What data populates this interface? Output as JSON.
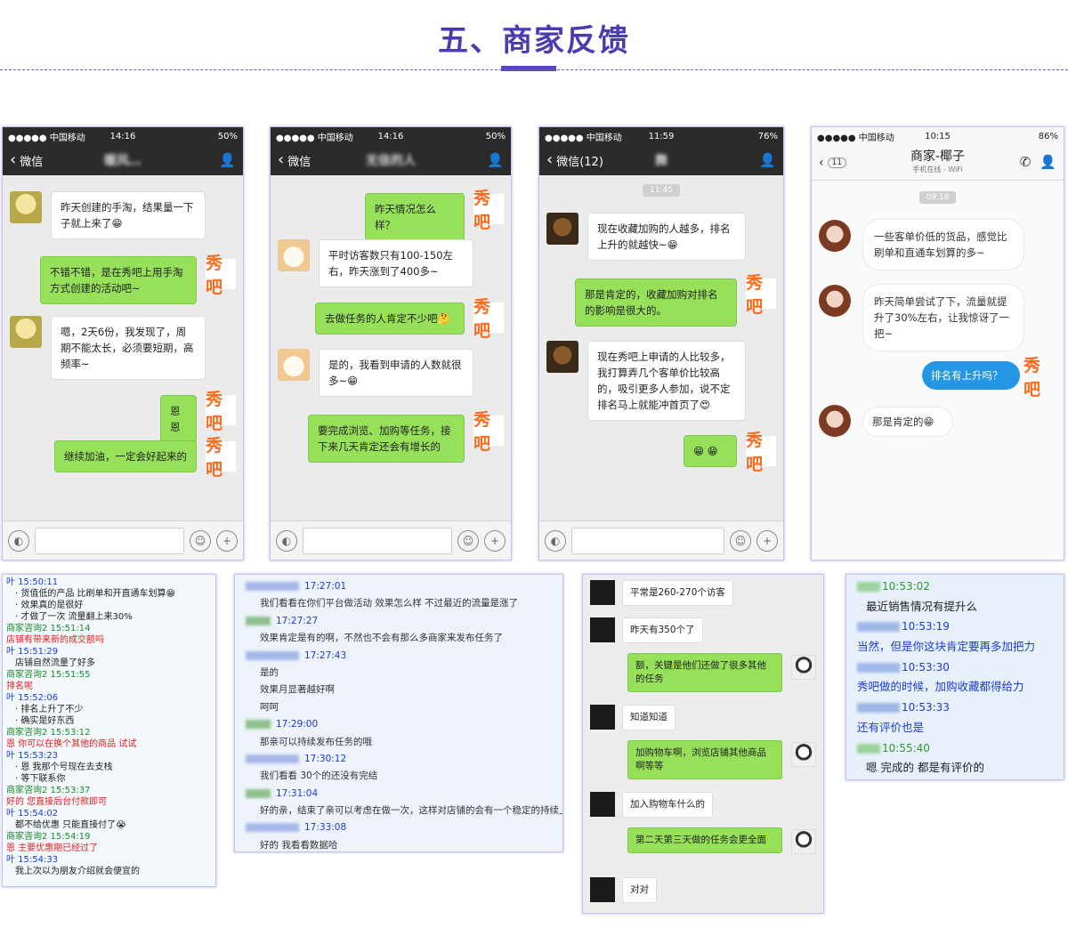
{
  "page": {
    "title": "五、商家反馈"
  },
  "xiuba_label": "秀吧",
  "phone1": {
    "carrier": "●●●●● 中国移动 ",
    "time": "14:16",
    "battery": "50%",
    "back": "微信",
    "contact": "暖风…",
    "messages": [
      {
        "text": "昨天创建的手淘，结果量一下子就上来了😁"
      },
      {
        "text": "不错不错，是在秀吧上用手淘方式创建的活动吧~"
      },
      {
        "text": "嗯，2天6份，我发现了，周期不能太长，必须要短期，高频率~"
      },
      {
        "text": "恩恩"
      },
      {
        "text": "继续加油，一定会好起来的"
      }
    ]
  },
  "phone2": {
    "carrier": "●●●●● 中国移动 ",
    "time": "14:16",
    "battery": "50%",
    "back": "微信",
    "contact": "无信的人",
    "messages": [
      {
        "text": "昨天情况怎么样？"
      },
      {
        "text": "平时访客数只有100-150左右，昨天涨到了400多~"
      },
      {
        "text": "去做任务的人肯定不少吧🤔"
      },
      {
        "text": "是的，我看到申请的人数就很多~😁"
      },
      {
        "text": "要完成浏览、加购等任务，接下来几天肯定还会有增长的"
      }
    ]
  },
  "phone3": {
    "carrier": "●●●●● 中国移动 ",
    "time": "11:59",
    "battery": "76%",
    "back": "微信(12)",
    "contact": "舞",
    "timestamp": "11:45",
    "messages": [
      {
        "text": "现在收藏加购的人越多，排名上升的就越快~😁"
      },
      {
        "text": "那是肯定的，收藏加购对排名的影响是很大的。"
      },
      {
        "text": "现在秀吧上申请的人比较多，我打算弄几个客单价比较高的，吸引更多人参加，说不定排名马上就能冲首页了😍"
      },
      {
        "text": "😁 😁"
      }
    ]
  },
  "phone4": {
    "carrier": "●●●●● 中国移动 ",
    "time": "10:15",
    "battery": "86%",
    "back_count": "11",
    "contact": "商家-椰子",
    "subtitle": "手机在线 - WiFi",
    "timestamp": "09:18",
    "messages": [
      {
        "text": "一些客单价低的货品，感觉比刷单和直通车划算的多~"
      },
      {
        "text": "昨天简单尝试了下，流量就提升了30%左右，让我惊讶了一把~"
      },
      {
        "text": "排名有上升吗？"
      },
      {
        "text": "那是肯定的😁"
      }
    ]
  },
  "qq": {
    "lines": [
      {
        "c": "b",
        "t": "叶   15:50:11"
      },
      {
        "c": "k",
        "t": "· 货值低的产品  比刷单和开直通车划算😁"
      },
      {
        "c": "k",
        "t": "· 效果真的是很好"
      },
      {
        "c": "k",
        "t": "· 才做了一次  流量翻上来30%"
      },
      {
        "c": "g",
        "t": "商家咨询2   15:51:14"
      },
      {
        "c": "r",
        "t": "    店铺有带来新的成交额吗"
      },
      {
        "c": "b",
        "t": "叶   15:51:29"
      },
      {
        "c": "k",
        "t": "店铺自然流量了好多"
      },
      {
        "c": "g",
        "t": "商家咨询2   15:51:55"
      },
      {
        "c": "r",
        "t": "    排名呢"
      },
      {
        "c": "b",
        "t": "叶   15:52:06"
      },
      {
        "c": "k",
        "t": "· 排名上升了不少"
      },
      {
        "c": "k",
        "t": "· 确实是好东西"
      },
      {
        "c": "g",
        "t": "商家咨询2   15:53:12"
      },
      {
        "c": "r",
        "t": "    恩  你可以在换个其他的商品  试试"
      },
      {
        "c": "b",
        "t": "叶   15:53:23"
      },
      {
        "c": "k",
        "t": "· 恩  我那个号现在去支栈"
      },
      {
        "c": "k",
        "t": "· 等下联系你"
      },
      {
        "c": "g",
        "t": "商家咨询2   15:53:37"
      },
      {
        "c": "r",
        "t": "    好的   您直接后台付款即可"
      },
      {
        "c": "b",
        "t": "叶   15:54:02"
      },
      {
        "c": "k",
        "t": "都不给优惠  只能直接付了😭"
      },
      {
        "c": "g",
        "t": "商家咨询2   15:54:19"
      },
      {
        "c": "r",
        "t": "    恩  主要优惠期已经过了"
      },
      {
        "c": "b",
        "t": "叶   15:54:33"
      },
      {
        "c": "k",
        "t": "我上次以为朋友介绍就会便宜的"
      }
    ]
  },
  "ww": {
    "rows": [
      {
        "type": "head",
        "t": "17:27:01",
        "g": false
      },
      {
        "type": "msg",
        "t": "我们看看在你们平台做活动 效果怎么样    不过最近的流量是涨了"
      },
      {
        "type": "head",
        "t": "17:27:27",
        "g": true
      },
      {
        "type": "msg",
        "t": "效果肯定是有的啊，不然也不会有那么多商家来发布任务了"
      },
      {
        "type": "head",
        "t": "17:27:43",
        "g": false
      },
      {
        "type": "msg",
        "t": "是的"
      },
      {
        "type": "msg",
        "t": "效果月显著越好啊"
      },
      {
        "type": "msg",
        "t": "呵呵"
      },
      {
        "type": "head",
        "t": "17:29:00",
        "g": true
      },
      {
        "type": "msg",
        "t": "那亲可以持续发布任务的哦"
      },
      {
        "type": "head",
        "t": "17:30:12",
        "g": false
      },
      {
        "type": "msg",
        "t": "我们看看 30个的还没有完结"
      },
      {
        "type": "head",
        "t": "17:31:04",
        "g": true
      },
      {
        "type": "msg",
        "t": "好的亲，结束了亲可以考虑在做一次，这样对店铺的会有一个稳定的持续上涨"
      },
      {
        "type": "head",
        "t": "17:33:08",
        "g": false
      },
      {
        "type": "msg",
        "t": "好的   我看看数据哈"
      }
    ]
  },
  "wx2": {
    "messages": [
      {
        "text": "平常是260-270个访客"
      },
      {
        "text": "昨天有350个了"
      },
      {
        "text": "额，关键是他们还做了很多其他的任务"
      },
      {
        "text": "知道知道"
      },
      {
        "text": "加购物车啊，浏览店铺其他商品啊等等"
      },
      {
        "text": "加入购物车什么的"
      },
      {
        "text": "第二天第三天做的任务会更全面"
      },
      {
        "text": "对对"
      }
    ]
  },
  "pc": {
    "rows": [
      {
        "type": "h",
        "t": "10:53:02",
        "g": true
      },
      {
        "type": "m",
        "t": "最近销售情况有提升么",
        "c": "dark"
      },
      {
        "type": "h",
        "t": "10:53:19",
        "g": false
      },
      {
        "type": "m",
        "t": "当然，但是你这块肯定要再多加把力",
        "c": "blue"
      },
      {
        "type": "h",
        "t": "10:53:30",
        "g": false
      },
      {
        "type": "m",
        "t": "秀吧做的时候，加购收藏都得给力",
        "c": "blue"
      },
      {
        "type": "h",
        "t": "10:53:33",
        "g": false
      },
      {
        "type": "m",
        "t": "还有评价也是",
        "c": "blue"
      },
      {
        "type": "h",
        "t": "10:55:40",
        "g": true
      },
      {
        "type": "m",
        "t": "嗯 完成的 都是有评价的",
        "c": "dark"
      }
    ]
  }
}
